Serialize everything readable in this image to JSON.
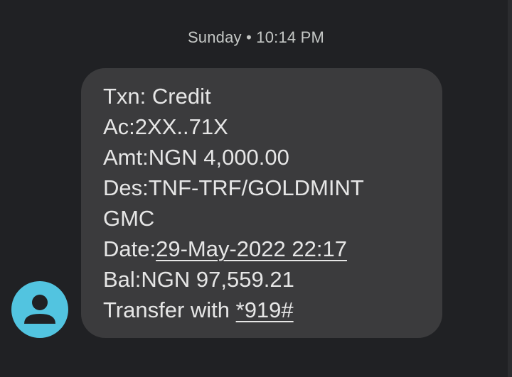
{
  "conversation": {
    "timestamp": "Sunday • 10:14 PM"
  },
  "sender": {
    "avatar_icon": "person-icon",
    "avatar_color": "#52c4e0"
  },
  "message": {
    "bubble_color": "#3b3b3d",
    "lines": {
      "txn": "Txn: Credit",
      "account": "Ac:2XX..71X",
      "amount": "Amt:NGN 4,000.00",
      "description_1": "Des:TNF-TRF/GOLDMINT",
      "description_2": "GMC",
      "date_prefix": "Date:",
      "date_link": "29-May-2022 22:17",
      "balance": "Bal:NGN 97,559.21",
      "transfer_prefix": "Transfer with ",
      "transfer_link": "*919#"
    }
  }
}
